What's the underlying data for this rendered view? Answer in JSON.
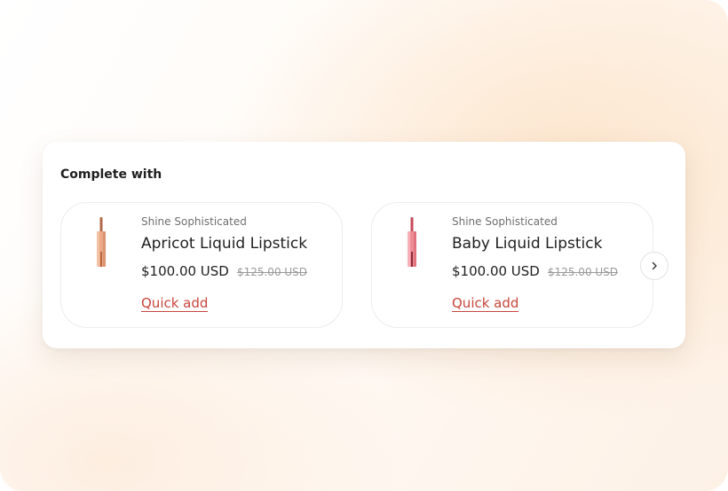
{
  "section": {
    "title": "Complete with"
  },
  "products": [
    {
      "vendor": "Shine Sophisticated",
      "name": "Apricot Liquid Lipstick",
      "price": "$100.00 USD",
      "compare_price": "$125.00 USD",
      "action_label": "Quick add",
      "image_icon": "lipstick-image",
      "tube_color": "#e9a27c",
      "cap_color": "#c9744f"
    },
    {
      "vendor": "Shine Sophisticated",
      "name": "Baby Liquid Lipstick",
      "price": "$100.00 USD",
      "compare_price": "$125.00 USD",
      "action_label": "Quick add",
      "image_icon": "lipstick-image",
      "tube_color": "#ef8a93",
      "cap_color": "#d45566"
    }
  ],
  "navigation": {
    "next_icon": "chevron-right-icon"
  },
  "colors": {
    "link": "#c8453c",
    "text": "#1f1f1f",
    "muted": "#6f6f6f"
  }
}
